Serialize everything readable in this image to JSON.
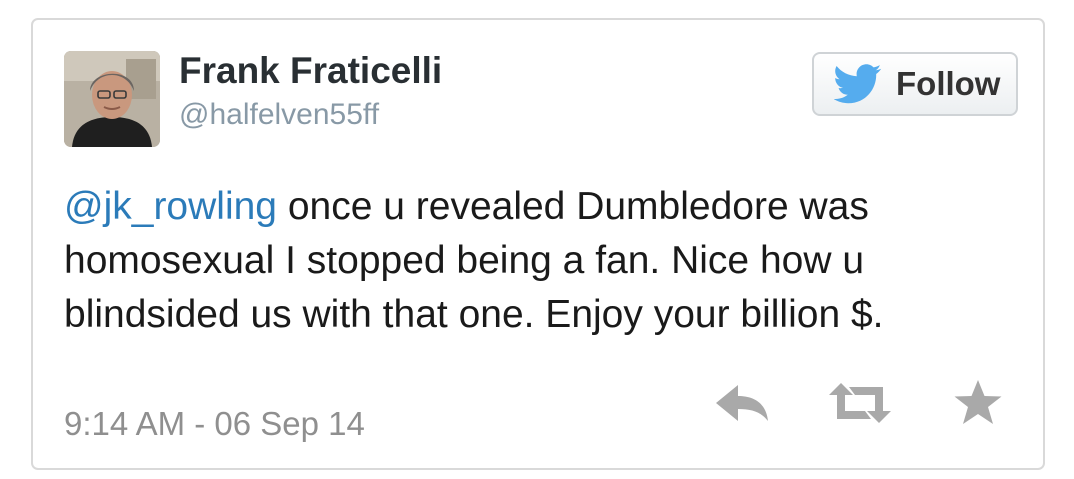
{
  "user": {
    "display_name": "Frank Fraticelli",
    "handle": "@halfelven55ff"
  },
  "follow_button": {
    "label": "Follow",
    "icon": "twitter-bird-icon"
  },
  "tweet": {
    "mention": "@jk_rowling",
    "body": " once u revealed Dumbledore was homosexual I stopped being a fan. Nice how u blindsided us with that one. Enjoy your billion $.",
    "timestamp": "9:14 AM - 06 Sep 14"
  },
  "actions": {
    "reply_icon": "reply-icon",
    "retweet_icon": "retweet-icon",
    "favorite_icon": "star-icon"
  },
  "colors": {
    "link": "#2b7bb9",
    "bird": "#55acee",
    "action_icon": "#a9a9a9",
    "meta_text": "#8f8f8f"
  }
}
